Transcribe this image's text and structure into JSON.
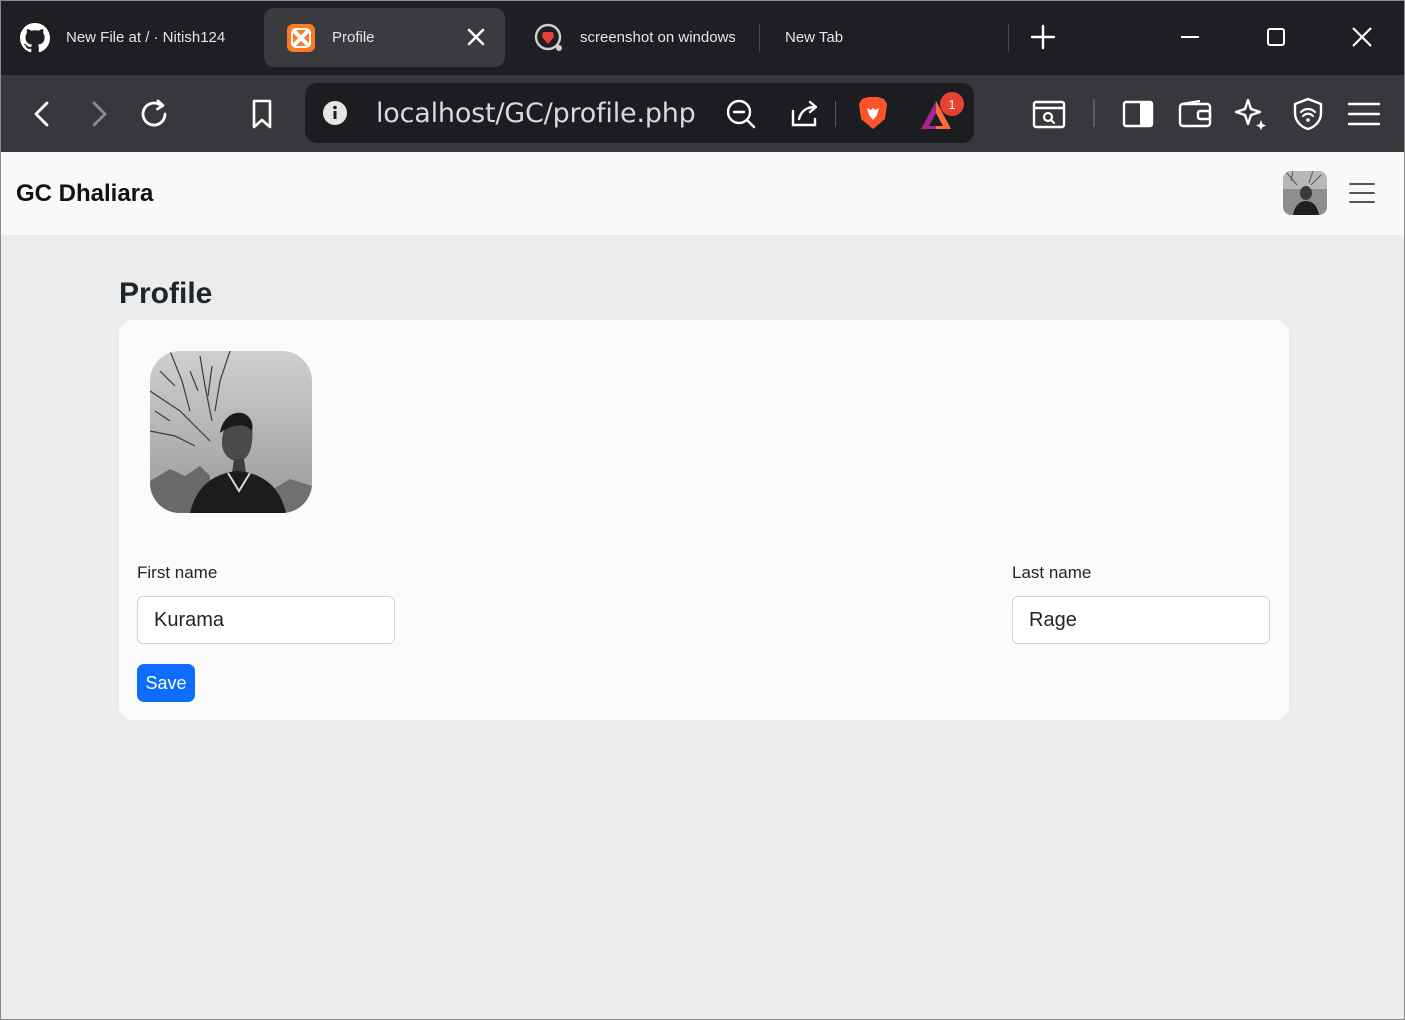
{
  "browser": {
    "tabs": [
      {
        "title": "New File at / · Nitish124",
        "icon": "github-icon",
        "active": false
      },
      {
        "title": "Profile",
        "icon": "xampp-icon",
        "active": true
      },
      {
        "title": "screenshot on windows",
        "icon": "brave-search-icon",
        "active": false
      },
      {
        "title": "New Tab",
        "icon": "",
        "active": false
      }
    ],
    "url": "localhost/GC/profile.php",
    "rewards_badge": "1",
    "colors": {
      "tabbar": "#1e1f22",
      "toolbar": "#37383c",
      "brave_orange": "#fb542b"
    }
  },
  "navbar": {
    "brand": "GC Dhaliara",
    "avatar_icon": "user-avatar",
    "toggler_icon": "hamburger-icon"
  },
  "page": {
    "title": "Profile",
    "form": {
      "first_name_label": "First name",
      "first_name_value": "Kurama",
      "last_name_label": "Last name",
      "last_name_value": "Rage",
      "save_label": "Save"
    },
    "colors": {
      "primary": "#0d6efd",
      "background": "#ebecee",
      "card": "#fbfbfb"
    }
  }
}
